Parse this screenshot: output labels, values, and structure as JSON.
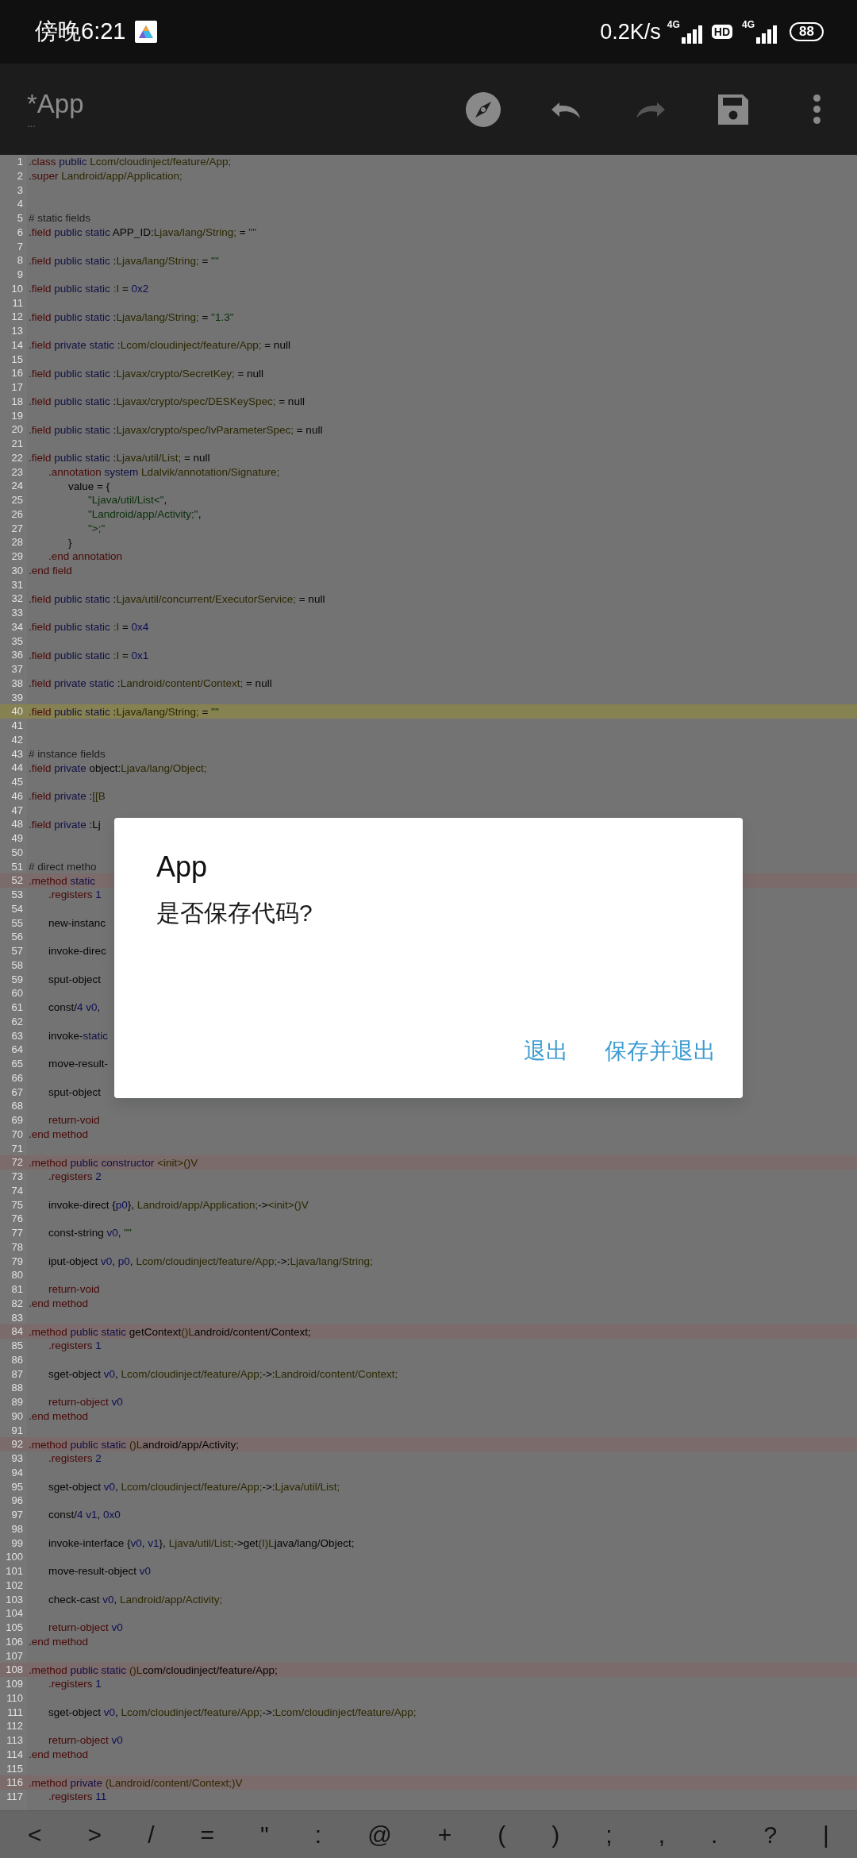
{
  "status_bar": {
    "time": "傍晚6:21",
    "network_speed": "0.2K/s",
    "sim1_type": "4G",
    "hd": "HD",
    "sim2_type": "4G",
    "battery": "88"
  },
  "toolbar": {
    "title": "*App",
    "subtitle": "...",
    "actions": [
      {
        "kind": "compass",
        "disabled": false
      },
      {
        "kind": "undo",
        "disabled": false
      },
      {
        "kind": "redo",
        "disabled": true
      },
      {
        "kind": "save",
        "disabled": false
      },
      {
        "kind": "more",
        "disabled": false
      }
    ]
  },
  "editor": {
    "lines": [
      {
        "number": "1",
        "text": ".class public Lcom/cloudinject/feature/App;",
        "kind": "code",
        "current": false
      },
      {
        "number": "2",
        "text": ".super Landroid/app/Application;",
        "kind": "code",
        "current": false
      },
      {
        "number": "3",
        "kind": "code",
        "current": false
      },
      {
        "number": "4",
        "kind": "code",
        "current": false
      },
      {
        "number": "5",
        "text": "# static fields",
        "kind": "code",
        "current": false
      },
      {
        "number": "6",
        "text": ".field public static APP_ID:Ljava/lang/String; = \"\"",
        "kind": "code",
        "current": false
      },
      {
        "number": "7",
        "kind": "code",
        "current": false
      },
      {
        "number": "8",
        "text": ".field public static :Ljava/lang/String; = \"\"",
        "kind": "code",
        "current": false
      },
      {
        "number": "9",
        "kind": "code",
        "current": false
      },
      {
        "number": "10",
        "text": ".field public static :I = 0x2",
        "kind": "code",
        "current": false
      },
      {
        "number": "11",
        "kind": "code",
        "current": false
      },
      {
        "number": "12",
        "text": ".field public static :Ljava/lang/String; = \"1.3\"",
        "kind": "code",
        "current": false
      },
      {
        "number": "13",
        "kind": "code",
        "current": false
      },
      {
        "number": "14",
        "text": ".field private static :Lcom/cloudinject/feature/App; = null",
        "kind": "code",
        "current": false
      },
      {
        "number": "15",
        "kind": "code",
        "current": false
      },
      {
        "number": "16",
        "text": ".field public static :Ljavax/crypto/SecretKey; = null",
        "kind": "code",
        "current": false
      },
      {
        "number": "17",
        "kind": "code",
        "current": false
      },
      {
        "number": "18",
        "text": ".field public static :Ljavax/crypto/spec/DESKeySpec; = null",
        "kind": "code",
        "current": false
      },
      {
        "number": "19",
        "kind": "code",
        "current": false
      },
      {
        "number": "20",
        "text": ".field public static :Ljavax/crypto/spec/IvParameterSpec; = null",
        "kind": "code",
        "current": false
      },
      {
        "number": "21",
        "kind": "code",
        "current": false
      },
      {
        "number": "22",
        "text": ".field public static :Ljava/util/List; = null",
        "kind": "code",
        "current": false
      },
      {
        "number": "23",
        "text": "\t.annotation system Ldalvik/annotation/Signature;",
        "kind": "code",
        "current": false
      },
      {
        "number": "24",
        "text": "\t\tvalue = {",
        "kind": "code",
        "current": false
      },
      {
        "number": "25",
        "text": "\t\t\t\"Ljava/util/List<\",",
        "kind": "code",
        "current": false
      },
      {
        "number": "26",
        "text": "\t\t\t\"Landroid/app/Activity;\",",
        "kind": "code",
        "current": false
      },
      {
        "number": "27",
        "text": "\t\t\t\">;\"",
        "kind": "code",
        "current": false
      },
      {
        "number": "28",
        "text": "\t\t}",
        "kind": "code",
        "current": false
      },
      {
        "number": "29",
        "text": "\t.end annotation",
        "kind": "code",
        "current": false
      },
      {
        "number": "30",
        "text": ".end field",
        "kind": "code",
        "current": false
      },
      {
        "number": "31",
        "kind": "code",
        "current": false
      },
      {
        "number": "32",
        "text": ".field public static :Ljava/util/concurrent/ExecutorService; = null",
        "kind": "code",
        "current": false
      },
      {
        "number": "33",
        "kind": "code",
        "current": false
      },
      {
        "number": "34",
        "text": ".field public static :I = 0x4",
        "kind": "code",
        "current": false
      },
      {
        "number": "35",
        "kind": "code",
        "current": false
      },
      {
        "number": "36",
        "text": ".field public static :I = 0x1",
        "kind": "code",
        "current": false
      },
      {
        "number": "37",
        "kind": "code",
        "current": false
      },
      {
        "number": "38",
        "text": ".field private static :Landroid/content/Context; = null",
        "kind": "code",
        "current": false
      },
      {
        "number": "39",
        "kind": "code",
        "current": false
      },
      {
        "number": "40",
        "text": ".field public static :Ljava/lang/String; = \"\"",
        "kind": "code",
        "current": true
      },
      {
        "number": "41",
        "kind": "code",
        "current": false
      },
      {
        "number": "42",
        "kind": "code",
        "current": false
      },
      {
        "number": "43",
        "text": "# instance fields",
        "kind": "code",
        "current": false
      },
      {
        "number": "44",
        "text": ".field private object:Ljava/lang/Object;",
        "kind": "code",
        "current": false
      },
      {
        "number": "45",
        "kind": "code",
        "current": false
      },
      {
        "number": "46",
        "text": ".field private :[[B",
        "kind": "code",
        "current": false
      },
      {
        "number": "47",
        "kind": "code",
        "current": false
      },
      {
        "number": "48",
        "text": ".field private :Lj",
        "kind": "code",
        "current": false
      },
      {
        "number": "49",
        "kind": "code",
        "current": false
      },
      {
        "number": "50",
        "kind": "code",
        "current": false
      },
      {
        "number": "51",
        "text": "# direct metho",
        "kind": "code",
        "current": false
      },
      {
        "number": "52",
        "text": ".method static",
        "kind": "method",
        "current": false
      },
      {
        "number": "53",
        "text": "\t.registers 1",
        "kind": "code",
        "current": false
      },
      {
        "number": "54",
        "kind": "code",
        "current": false
      },
      {
        "number": "55",
        "text": "\tnew-instanc",
        "kind": "code",
        "current": false
      },
      {
        "number": "56",
        "kind": "code",
        "current": false
      },
      {
        "number": "57",
        "text": "\tinvoke-direc",
        "kind": "code",
        "current": false
      },
      {
        "number": "58",
        "kind": "code",
        "current": false
      },
      {
        "number": "59",
        "text": "\tsput-object",
        "kind": "code",
        "current": false
      },
      {
        "number": "60",
        "kind": "code",
        "current": false
      },
      {
        "number": "61",
        "text": "\tconst/4 v0,",
        "kind": "code",
        "current": false
      },
      {
        "number": "62",
        "kind": "code",
        "current": false
      },
      {
        "number": "63",
        "text": "\tinvoke-static",
        "kind": "code",
        "current": false
      },
      {
        "number": "64",
        "kind": "code",
        "current": false
      },
      {
        "number": "65",
        "text": "\tmove-result-",
        "kind": "code",
        "current": false
      },
      {
        "number": "66",
        "kind": "code",
        "current": false
      },
      {
        "number": "67",
        "text": "\tsput-object",
        "kind": "code",
        "current": false
      },
      {
        "number": "68",
        "kind": "code",
        "current": false
      },
      {
        "number": "69",
        "text": "\treturn-void",
        "kind": "code",
        "current": false
      },
      {
        "number": "70",
        "text": ".end method",
        "kind": "code",
        "current": false
      },
      {
        "number": "71",
        "kind": "code",
        "current": false
      },
      {
        "number": "72",
        "text": ".method public constructor <init>()V",
        "kind": "method",
        "current": false
      },
      {
        "number": "73",
        "text": "\t.registers 2",
        "kind": "code",
        "current": false
      },
      {
        "number": "74",
        "kind": "code",
        "current": false
      },
      {
        "number": "75",
        "text": "\tinvoke-direct {p0}, Landroid/app/Application;-><init>()V",
        "kind": "code",
        "current": false
      },
      {
        "number": "76",
        "kind": "code",
        "current": false
      },
      {
        "number": "77",
        "text": "\tconst-string v0, \"\"",
        "kind": "code",
        "current": false
      },
      {
        "number": "78",
        "kind": "code",
        "current": false
      },
      {
        "number": "79",
        "text": "\tiput-object v0, p0, Lcom/cloudinject/feature/App;->:Ljava/lang/String;",
        "kind": "code",
        "current": false
      },
      {
        "number": "80",
        "kind": "code",
        "current": false
      },
      {
        "number": "81",
        "text": "\treturn-void",
        "kind": "code",
        "current": false
      },
      {
        "number": "82",
        "text": ".end method",
        "kind": "code",
        "current": false
      },
      {
        "number": "83",
        "kind": "code",
        "current": false
      },
      {
        "number": "84",
        "text": ".method public static getContext()Landroid/content/Context;",
        "kind": "method",
        "current": false
      },
      {
        "number": "85",
        "text": "\t.registers 1",
        "kind": "code",
        "current": false
      },
      {
        "number": "86",
        "kind": "code",
        "current": false
      },
      {
        "number": "87",
        "text": "\tsget-object v0, Lcom/cloudinject/feature/App;->:Landroid/content/Context;",
        "kind": "code",
        "current": false
      },
      {
        "number": "88",
        "kind": "code",
        "current": false
      },
      {
        "number": "89",
        "text": "\treturn-object v0",
        "kind": "code",
        "current": false
      },
      {
        "number": "90",
        "text": ".end method",
        "kind": "code",
        "current": false
      },
      {
        "number": "91",
        "kind": "code",
        "current": false
      },
      {
        "number": "92",
        "text": ".method public static ()Landroid/app/Activity;",
        "kind": "method",
        "current": false
      },
      {
        "number": "93",
        "text": "\t.registers 2",
        "kind": "code",
        "current": false
      },
      {
        "number": "94",
        "kind": "code",
        "current": false
      },
      {
        "number": "95",
        "text": "\tsget-object v0, Lcom/cloudinject/feature/App;->:Ljava/util/List;",
        "kind": "code",
        "current": false
      },
      {
        "number": "96",
        "kind": "code",
        "current": false
      },
      {
        "number": "97",
        "text": "\tconst/4 v1, 0x0",
        "kind": "code",
        "current": false
      },
      {
        "number": "98",
        "kind": "code",
        "current": false
      },
      {
        "number": "99",
        "text": "\tinvoke-interface {v0, v1}, Ljava/util/List;->get(I)Ljava/lang/Object;",
        "kind": "code",
        "current": false
      },
      {
        "number": "100",
        "kind": "code",
        "current": false
      },
      {
        "number": "101",
        "text": "\tmove-result-object v0",
        "kind": "code",
        "current": false
      },
      {
        "number": "102",
        "kind": "code",
        "current": false
      },
      {
        "number": "103",
        "text": "\tcheck-cast v0, Landroid/app/Activity;",
        "kind": "code",
        "current": false
      },
      {
        "number": "104",
        "kind": "code",
        "current": false
      },
      {
        "number": "105",
        "text": "\treturn-object v0",
        "kind": "code",
        "current": false
      },
      {
        "number": "106",
        "text": ".end method",
        "kind": "code",
        "current": false
      },
      {
        "number": "107",
        "kind": "code",
        "current": false
      },
      {
        "number": "108",
        "text": ".method public static ()Lcom/cloudinject/feature/App;",
        "kind": "method",
        "current": false
      },
      {
        "number": "109",
        "text": "\t.registers 1",
        "kind": "code",
        "current": false
      },
      {
        "number": "110",
        "kind": "code",
        "current": false
      },
      {
        "number": "111",
        "text": "\tsget-object v0, Lcom/cloudinject/feature/App;->:Lcom/cloudinject/feature/App;",
        "kind": "code",
        "current": false
      },
      {
        "number": "112",
        "kind": "code",
        "current": false
      },
      {
        "number": "113",
        "text": "\treturn-object v0",
        "kind": "code",
        "current": false
      },
      {
        "number": "114",
        "text": ".end method",
        "kind": "code",
        "current": false
      },
      {
        "number": "115",
        "kind": "code",
        "current": false
      },
      {
        "number": "116",
        "text": ".method private (Landroid/content/Context;)V",
        "kind": "method",
        "current": false
      },
      {
        "number": "117",
        "text": "\t.registers 11",
        "kind": "code",
        "current": false
      }
    ]
  },
  "dialog": {
    "title": "App",
    "message": "是否保存代码?",
    "buttons": [
      "退出",
      "保存并退出"
    ]
  },
  "symbol_keys": [
    "<",
    ">",
    "/",
    "=",
    "\"",
    ":",
    "@",
    "+",
    "(",
    ")",
    ";",
    ",",
    ".",
    "?",
    "|"
  ]
}
